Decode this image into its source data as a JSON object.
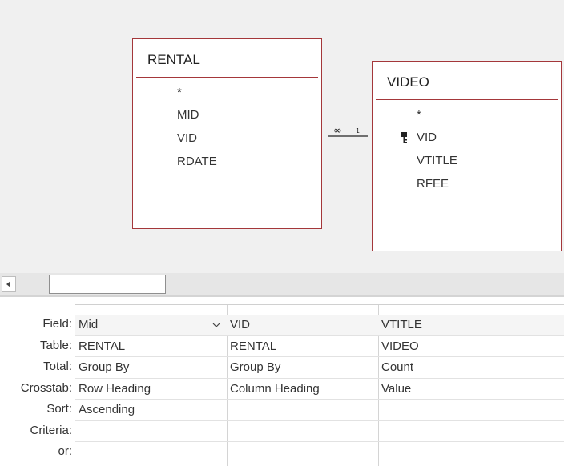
{
  "tables": {
    "rental": {
      "title": "RENTAL",
      "fields": [
        "*",
        "MID",
        "VID",
        "RDATE"
      ]
    },
    "video": {
      "title": "VIDEO",
      "fields": [
        "*",
        "VID",
        "VTITLE",
        "RFEE"
      ]
    }
  },
  "relationship": {
    "many_side": "∞",
    "one_side": "1"
  },
  "row_labels": [
    "Field:",
    "Table:",
    "Total:",
    "Crosstab:",
    "Sort:",
    "Criteria:",
    "or:"
  ],
  "columns": [
    {
      "field": "Mid",
      "table": "RENTAL",
      "total": "Group By",
      "crosstab": "Row Heading",
      "sort": "Ascending",
      "criteria": "",
      "or": ""
    },
    {
      "field": "VID",
      "table": "RENTAL",
      "total": "Group By",
      "crosstab": "Column Heading",
      "sort": "",
      "criteria": "",
      "or": ""
    },
    {
      "field": "VTITLE",
      "table": "VIDEO",
      "total": "Count",
      "crosstab": "Value",
      "sort": "",
      "criteria": "",
      "or": ""
    },
    {
      "field": "",
      "table": "",
      "total": "",
      "crosstab": "",
      "sort": "",
      "criteria": "",
      "or": ""
    }
  ]
}
